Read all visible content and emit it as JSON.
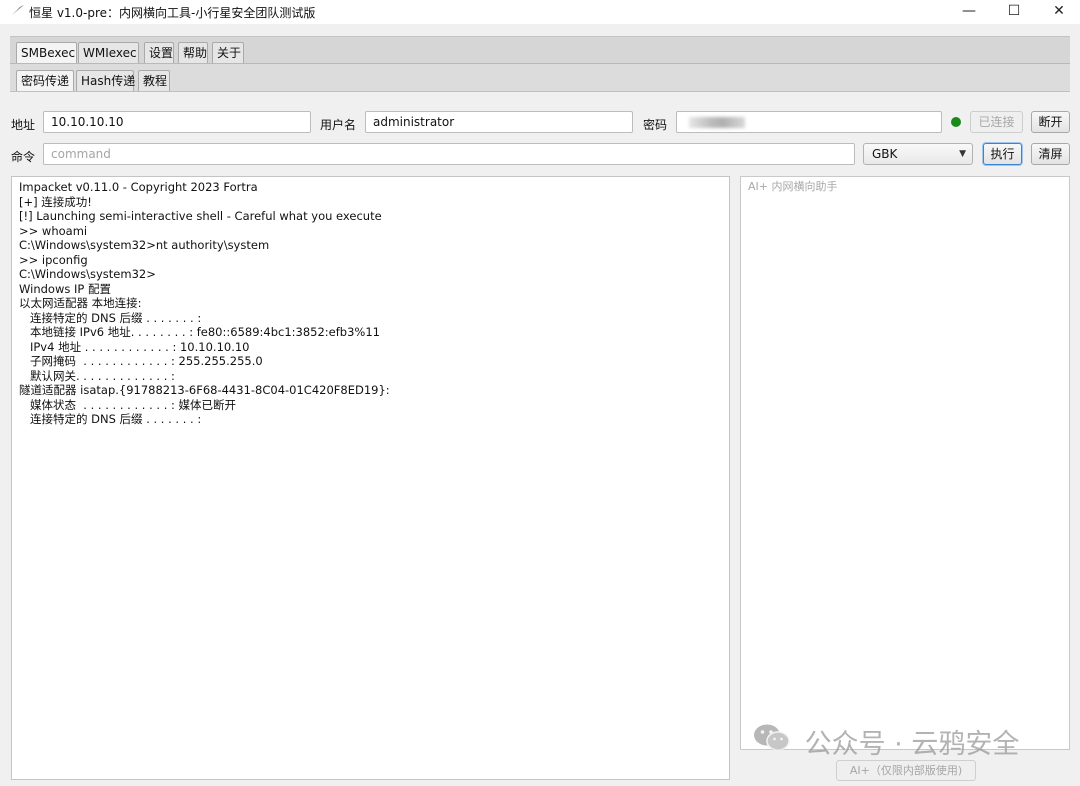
{
  "window": {
    "icon": "feather-icon",
    "title": "恒星 v1.0-pre：内网横向工具-小行星安全团队测试版",
    "min_glyph": "—",
    "max_glyph": "☐",
    "close_glyph": "✕"
  },
  "top_tabs": [
    {
      "label": "SMBexec",
      "active": true
    },
    {
      "label": "WMIexec",
      "active": false
    },
    {
      "label": "设置",
      "active": false
    },
    {
      "label": "帮助",
      "active": false
    },
    {
      "label": "关于",
      "active": false
    }
  ],
  "sub_tabs": [
    {
      "label": "密码传递",
      "active": true
    },
    {
      "label": "Hash传递",
      "active": false
    },
    {
      "label": "教程",
      "active": false
    }
  ],
  "connection": {
    "address_label": "地址",
    "address_value": "10.10.10.10",
    "username_label": "用户名",
    "username_value": "administrator",
    "password_label": "密码",
    "status_color": "#1a8a1a",
    "connected_label": "已连接",
    "disconnect_label": "断开"
  },
  "command": {
    "label": "命令",
    "placeholder": "command",
    "encoding": "GBK",
    "execute_label": "执行",
    "clear_label": "清屏"
  },
  "console_lines": [
    "Impacket v0.11.0 - Copyright 2023 Fortra",
    "[+] 连接成功!",
    "[!] Launching semi-interactive shell - Careful what you execute",
    ">> whoami",
    "C:\\Windows\\system32>nt authority\\system",
    ">> ipconfig",
    "C:\\Windows\\system32>",
    "Windows IP 配置",
    "以太网适配器 本地连接:",
    "   连接特定的 DNS 后缀 . . . . . . . :",
    "   本地链接 IPv6 地址. . . . . . . . : fe80::6589:4bc1:3852:efb3%11",
    "   IPv4 地址 . . . . . . . . . . . . : 10.10.10.10",
    "   子网掩码  . . . . . . . . . . . . : 255.255.255.0",
    "   默认网关. . . . . . . . . . . . . :",
    "隧道适配器 isatap.{91788213-6F68-4431-8C04-01C420F8ED19}:",
    "   媒体状态  . . . . . . . . . . . . : 媒体已断开",
    "   连接特定的 DNS 后缀 . . . . . . . :"
  ],
  "ai": {
    "placeholder": "AI+ 内网横向助手",
    "button_label": "AI+（仅限内部版使用)"
  },
  "watermark": {
    "icon": "wechat-icon",
    "text": "公众号 · 云鸦安全"
  }
}
